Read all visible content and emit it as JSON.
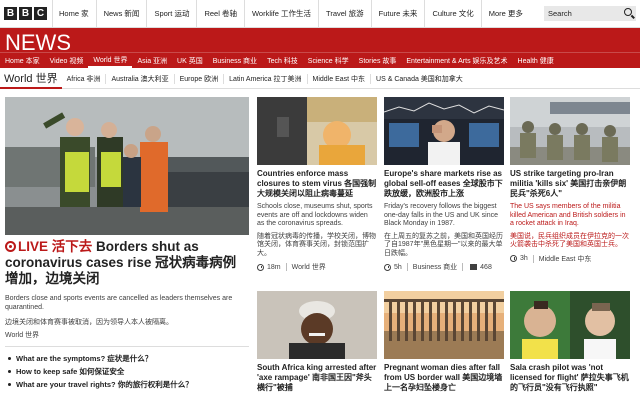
{
  "topbar": {
    "logo": [
      "B",
      "B",
      "C"
    ],
    "nav": [
      "Home 家",
      "News 新闻",
      "Sport 运动",
      "Reel 卷轴",
      "Worklife 工作生活",
      "Travel 旅游",
      "Future 未来",
      "Culture 文化",
      "More 更多"
    ],
    "search_placeholder": "Search"
  },
  "banner": {
    "title": "NEWS"
  },
  "rednav": {
    "items": [
      "Home 本家",
      "Video 视频",
      "World 世界",
      "Asia 亚洲",
      "UK 英国",
      "Business 商业",
      "Tech 科技",
      "Science 科学",
      "Stories 故事",
      "Entertainment & Arts 娱乐及艺术",
      "Health 健康"
    ],
    "active_index": 2
  },
  "subnav": {
    "section": "World 世界",
    "items": [
      "Africa 非洲",
      "Australia 澳大利亚",
      "Europe 欧洲",
      "Latin America 拉丁美洲",
      "Middle East 中东",
      "US & Canada 美国和加拿大"
    ]
  },
  "lead": {
    "live_label": "LIVE 活下去",
    "headline": "Borders shut as coronavirus cases rise 冠状病毒病例增加，边境关闭",
    "summary": "Borders close and sports events are cancelled as leaders themselves are quarantined.",
    "summary_zh": "边境关闭和体育赛事被取消，因为领导人本人被隔离。",
    "tag": "World 世界",
    "links": [
      "What are the symptoms? 症状是什么？",
      "How to keep safe 如何保证安全",
      "What are your travel rights? 你的旅行权利是什么？"
    ]
  },
  "cards": [
    {
      "title": "Countries enforce mass closures to stem virus 各国强制大规模关闭以阻止病毒蔓延",
      "summary": "Schools close, museums shut, sports events are off and lockdowns widen as the coronavirus spreads.",
      "summary_zh": "随着冠状病毒的传播，学校关闭，博物馆关闭，体育赛事关闭，封锁范围扩大。",
      "time": "18m",
      "tag": "World 世界"
    },
    {
      "title": "Europe's share markets rise as global sell-off eases 全球股市下跌放缓，欧洲股市上涨",
      "summary": "Friday's recovery follows the biggest one-day falls in the US and UK since Black Monday in 1987.",
      "summary_zh": "在上周五的复苏之前，美国和英国经历了自1987年\"黑色星期一\"以来的最大单日跌幅。",
      "time": "5h",
      "tag": "Business 商业",
      "comments": "468"
    },
    {
      "title": "US strike targeting pro-Iran militia 'kills six' 美国打击亲伊朗民兵\"杀死6人\"",
      "summary": "The US says members of the militia killed American and British soldiers in a rocket attack in Iraq.",
      "summary_zh": "美国说，民兵组织成员在伊拉克的一次火箭袭击中杀死了美国和英国士兵。",
      "time": "3h",
      "tag": "Middle East 中东"
    },
    {
      "title": "South Africa king arrested after 'axe rampage' 南非国王因\"斧头横行\"被捕"
    },
    {
      "title": "Pregnant woman dies after fall from US border wall 美国边境墙上一名孕妇坠楼身亡"
    },
    {
      "title": "Sala crash pilot was 'not licensed for flight' 萨拉失事飞机的飞行员\"没有飞行执照\""
    }
  ],
  "colors": {
    "brand_red": "#bb1919"
  }
}
